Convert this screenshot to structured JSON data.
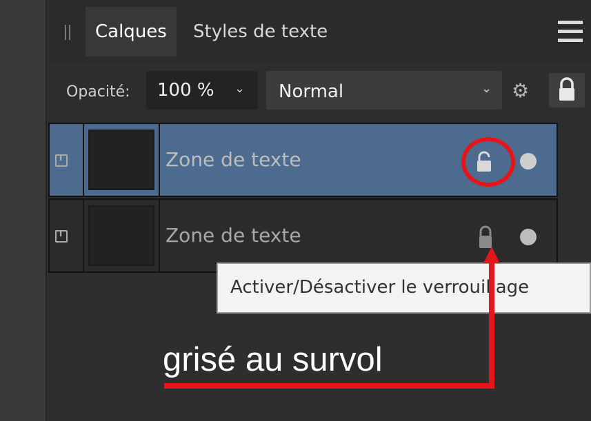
{
  "tabs": [
    {
      "label": "Calques",
      "active": true
    },
    {
      "label": "Styles de texte",
      "active": false
    }
  ],
  "options": {
    "opacity_label": "Opacité:",
    "opacity_value": "100 %",
    "blend_mode": "Normal"
  },
  "layers": [
    {
      "name": "Zone de texte",
      "selected": true
    },
    {
      "name": "Zone de texte",
      "selected": false
    }
  ],
  "tooltip": {
    "text": "Activer/Désactiver le verrouillage"
  },
  "annotation": {
    "text": "grisé au survol",
    "color": "#e4161b"
  },
  "icons": [
    "grip-icon",
    "hamburger-menu-icon",
    "chevron-down-icon",
    "gear-icon",
    "lock-icon",
    "text-layer-icon",
    "visibility-dot-icon"
  ],
  "colors": {
    "selected_row": "#4d6b8f",
    "panel_bg": "#2e2e2e",
    "tooltip_bg": "#f3f3f3"
  }
}
